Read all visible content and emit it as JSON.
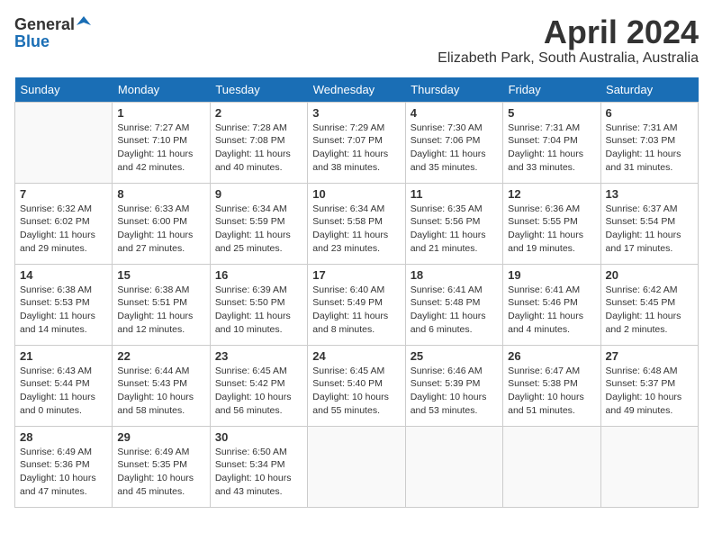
{
  "header": {
    "logo_general": "General",
    "logo_blue": "Blue",
    "month": "April 2024",
    "location": "Elizabeth Park, South Australia, Australia"
  },
  "days_of_week": [
    "Sunday",
    "Monday",
    "Tuesday",
    "Wednesday",
    "Thursday",
    "Friday",
    "Saturday"
  ],
  "weeks": [
    [
      {
        "day": "",
        "info": ""
      },
      {
        "day": "1",
        "info": "Sunrise: 7:27 AM\nSunset: 7:10 PM\nDaylight: 11 hours\nand 42 minutes."
      },
      {
        "day": "2",
        "info": "Sunrise: 7:28 AM\nSunset: 7:08 PM\nDaylight: 11 hours\nand 40 minutes."
      },
      {
        "day": "3",
        "info": "Sunrise: 7:29 AM\nSunset: 7:07 PM\nDaylight: 11 hours\nand 38 minutes."
      },
      {
        "day": "4",
        "info": "Sunrise: 7:30 AM\nSunset: 7:06 PM\nDaylight: 11 hours\nand 35 minutes."
      },
      {
        "day": "5",
        "info": "Sunrise: 7:31 AM\nSunset: 7:04 PM\nDaylight: 11 hours\nand 33 minutes."
      },
      {
        "day": "6",
        "info": "Sunrise: 7:31 AM\nSunset: 7:03 PM\nDaylight: 11 hours\nand 31 minutes."
      }
    ],
    [
      {
        "day": "7",
        "info": "Sunrise: 6:32 AM\nSunset: 6:02 PM\nDaylight: 11 hours\nand 29 minutes."
      },
      {
        "day": "8",
        "info": "Sunrise: 6:33 AM\nSunset: 6:00 PM\nDaylight: 11 hours\nand 27 minutes."
      },
      {
        "day": "9",
        "info": "Sunrise: 6:34 AM\nSunset: 5:59 PM\nDaylight: 11 hours\nand 25 minutes."
      },
      {
        "day": "10",
        "info": "Sunrise: 6:34 AM\nSunset: 5:58 PM\nDaylight: 11 hours\nand 23 minutes."
      },
      {
        "day": "11",
        "info": "Sunrise: 6:35 AM\nSunset: 5:56 PM\nDaylight: 11 hours\nand 21 minutes."
      },
      {
        "day": "12",
        "info": "Sunrise: 6:36 AM\nSunset: 5:55 PM\nDaylight: 11 hours\nand 19 minutes."
      },
      {
        "day": "13",
        "info": "Sunrise: 6:37 AM\nSunset: 5:54 PM\nDaylight: 11 hours\nand 17 minutes."
      }
    ],
    [
      {
        "day": "14",
        "info": "Sunrise: 6:38 AM\nSunset: 5:53 PM\nDaylight: 11 hours\nand 14 minutes."
      },
      {
        "day": "15",
        "info": "Sunrise: 6:38 AM\nSunset: 5:51 PM\nDaylight: 11 hours\nand 12 minutes."
      },
      {
        "day": "16",
        "info": "Sunrise: 6:39 AM\nSunset: 5:50 PM\nDaylight: 11 hours\nand 10 minutes."
      },
      {
        "day": "17",
        "info": "Sunrise: 6:40 AM\nSunset: 5:49 PM\nDaylight: 11 hours\nand 8 minutes."
      },
      {
        "day": "18",
        "info": "Sunrise: 6:41 AM\nSunset: 5:48 PM\nDaylight: 11 hours\nand 6 minutes."
      },
      {
        "day": "19",
        "info": "Sunrise: 6:41 AM\nSunset: 5:46 PM\nDaylight: 11 hours\nand 4 minutes."
      },
      {
        "day": "20",
        "info": "Sunrise: 6:42 AM\nSunset: 5:45 PM\nDaylight: 11 hours\nand 2 minutes."
      }
    ],
    [
      {
        "day": "21",
        "info": "Sunrise: 6:43 AM\nSunset: 5:44 PM\nDaylight: 11 hours\nand 0 minutes."
      },
      {
        "day": "22",
        "info": "Sunrise: 6:44 AM\nSunset: 5:43 PM\nDaylight: 10 hours\nand 58 minutes."
      },
      {
        "day": "23",
        "info": "Sunrise: 6:45 AM\nSunset: 5:42 PM\nDaylight: 10 hours\nand 56 minutes."
      },
      {
        "day": "24",
        "info": "Sunrise: 6:45 AM\nSunset: 5:40 PM\nDaylight: 10 hours\nand 55 minutes."
      },
      {
        "day": "25",
        "info": "Sunrise: 6:46 AM\nSunset: 5:39 PM\nDaylight: 10 hours\nand 53 minutes."
      },
      {
        "day": "26",
        "info": "Sunrise: 6:47 AM\nSunset: 5:38 PM\nDaylight: 10 hours\nand 51 minutes."
      },
      {
        "day": "27",
        "info": "Sunrise: 6:48 AM\nSunset: 5:37 PM\nDaylight: 10 hours\nand 49 minutes."
      }
    ],
    [
      {
        "day": "28",
        "info": "Sunrise: 6:49 AM\nSunset: 5:36 PM\nDaylight: 10 hours\nand 47 minutes."
      },
      {
        "day": "29",
        "info": "Sunrise: 6:49 AM\nSunset: 5:35 PM\nDaylight: 10 hours\nand 45 minutes."
      },
      {
        "day": "30",
        "info": "Sunrise: 6:50 AM\nSunset: 5:34 PM\nDaylight: 10 hours\nand 43 minutes."
      },
      {
        "day": "",
        "info": ""
      },
      {
        "day": "",
        "info": ""
      },
      {
        "day": "",
        "info": ""
      },
      {
        "day": "",
        "info": ""
      }
    ]
  ]
}
